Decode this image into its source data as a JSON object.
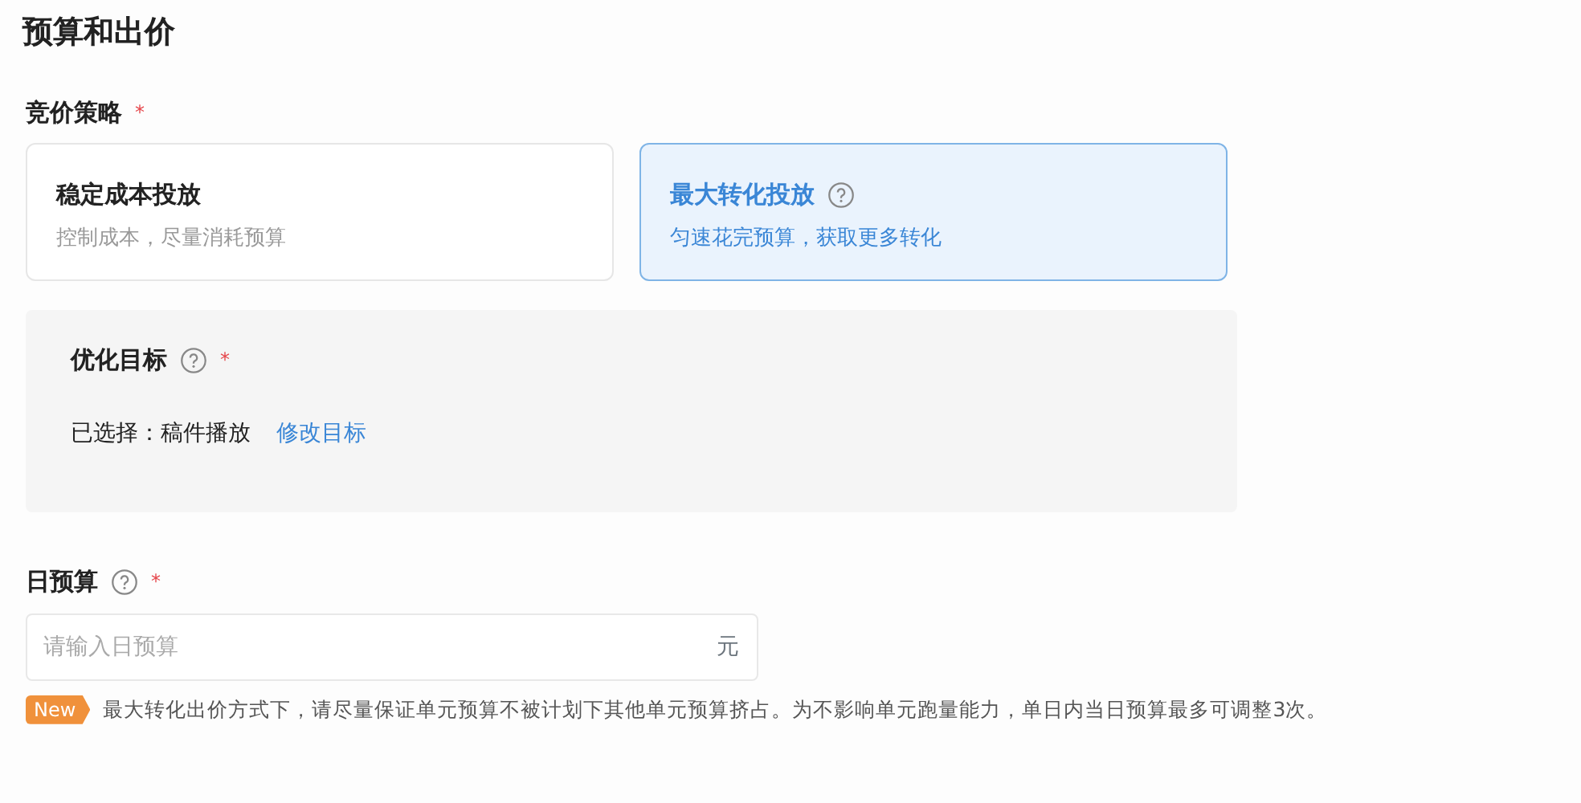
{
  "section_title": "预算和出价",
  "bid_strategy": {
    "label": "竞价策略",
    "required_mark": "*",
    "options": [
      {
        "title": "稳定成本投放",
        "description": "控制成本，尽量消耗预算",
        "help": false,
        "selected": false
      },
      {
        "title": "最大转化投放",
        "description": "匀速花完预算，获取更多转化",
        "help": true,
        "selected": true
      }
    ]
  },
  "optimization_goal": {
    "label": "优化目标",
    "required_mark": "*",
    "help": true,
    "selected_label": "已选择：",
    "selected_value": "稿件播放",
    "edit_link": "修改目标"
  },
  "daily_budget": {
    "label": "日预算",
    "required_mark": "*",
    "help": true,
    "placeholder": "请输入日预算",
    "suffix": "元"
  },
  "notice": {
    "badge": "New",
    "text": "最大转化出价方式下，请尽量保证单元预算不被计划下其他单元预算挤占。为不影响单元跑量能力，单日内当日预算最多可调整3次。"
  }
}
